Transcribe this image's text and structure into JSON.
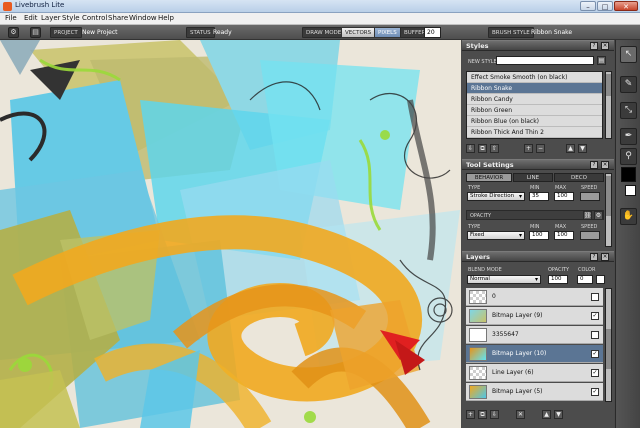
{
  "window": {
    "title": "Livebrush Lite",
    "min": "–",
    "max": "□",
    "close": "✕"
  },
  "menu": [
    "File",
    "Edit",
    "Layer",
    "Style",
    "Control",
    "Share",
    "Window",
    "Help"
  ],
  "toolbar": {
    "project_label": "PROJECT",
    "project_value": "New Project",
    "status_label": "STATUS",
    "status_value": "Ready",
    "draw_mode_label": "DRAW MODE",
    "vectors_label": "VECTORS",
    "pixels_label": "PIXELS",
    "buffer_label": "BUFFER",
    "buffer_value": "20",
    "brush_style_label": "BRUSH STYLE",
    "brush_style_value": "Ribbon Snake"
  },
  "styles_panel": {
    "title": "Styles",
    "new_style_label": "NEW STYLE",
    "new_style_value": "",
    "items": [
      "Effect Smoke Smooth (on black)",
      "Ribbon Snake",
      "Ribbon Candy",
      "Ribbon Green",
      "Ribbon Blue (on black)",
      "Ribbon Thick And Thin 2"
    ],
    "selected_index": 1
  },
  "tool_settings": {
    "title": "Tool Settings",
    "tabs": [
      "BEHAVIOR",
      "LINE",
      "DECO"
    ],
    "active_tab": 0,
    "type_label": "TYPE",
    "type_value": "Stroke Direction",
    "min_label": "MIN",
    "min_value": "35",
    "max_label": "MAX",
    "max_value": "100",
    "speed_label": "SPEED",
    "opacity_label": "OPACITY",
    "opacity_type_label": "TYPE",
    "opacity_type_value": "Fixed",
    "opacity_min_label": "MIN",
    "opacity_min_value": "100",
    "opacity_max_label": "MAX",
    "opacity_max_value": "100",
    "opacity_speed_label": "SPEED"
  },
  "layers_panel": {
    "title": "Layers",
    "blend_mode_label": "BLEND MODE",
    "blend_mode_value": "Normal",
    "opacity_label": "OPACITY",
    "opacity_value": "100",
    "color_label": "COLOR",
    "color_value": "0",
    "layers": [
      {
        "name": "0",
        "checked": false
      },
      {
        "name": "Bitmap Layer (9)",
        "checked": true
      },
      {
        "name": "3355647",
        "checked": false
      },
      {
        "name": "Bitmap Layer (10)",
        "checked": true
      },
      {
        "name": "Line Layer (6)",
        "checked": true
      },
      {
        "name": "Bitmap Layer (5)",
        "checked": true
      }
    ],
    "selected_index": 3
  },
  "panel_buttons": {
    "help": "?",
    "menu": "▾",
    "close": "✕"
  },
  "tools": [
    "pointer-icon",
    "brush-icon",
    "transform-icon",
    "pen-icon",
    "eyedropper-icon",
    "hand-icon"
  ],
  "colors": {
    "foreground": "#000000",
    "background": "#ffffff",
    "selection": "#5b7594"
  }
}
